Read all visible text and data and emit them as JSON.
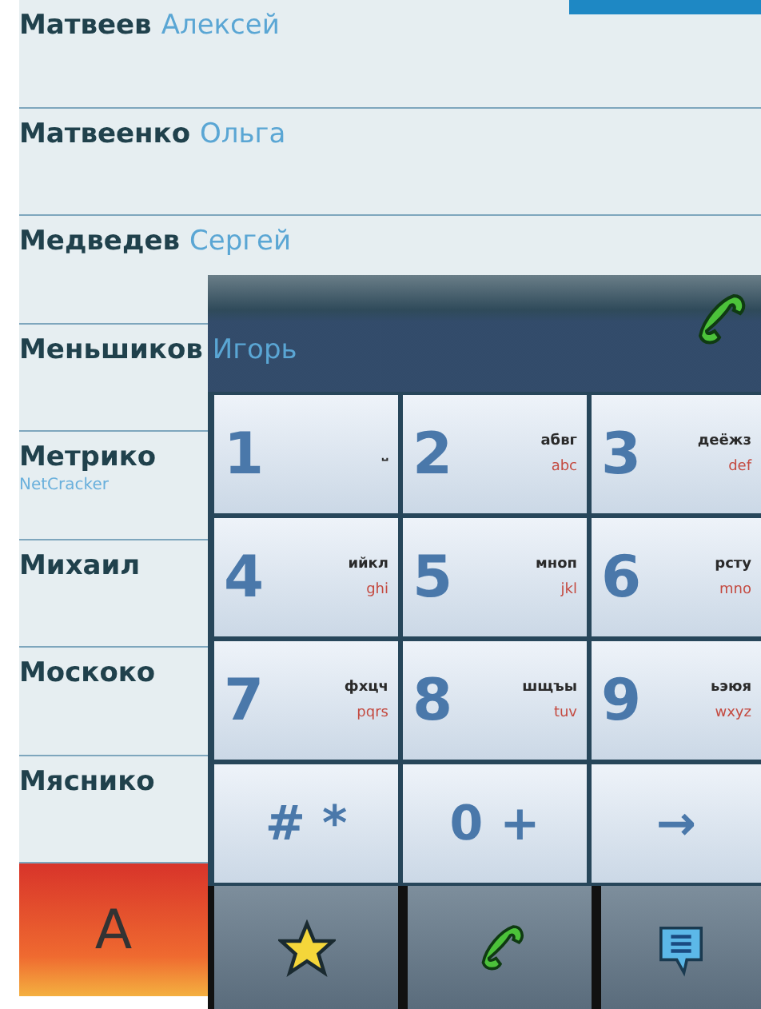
{
  "contacts": [
    {
      "surname": "Матвеев",
      "first_name": "Алексей"
    },
    {
      "surname": "Матвеенко",
      "first_name": "Ольга"
    },
    {
      "surname": "Медведев",
      "first_name": "Сергей"
    },
    {
      "surname": "Меньшиков",
      "first_name": "Игорь"
    },
    {
      "surname": "Метрико",
      "company": "NetCracker"
    },
    {
      "surname": "Михаил"
    },
    {
      "surname": "Москоко"
    },
    {
      "surname": "Мяснико"
    }
  ],
  "alphabet_button": {
    "label": "A",
    "selected": true
  },
  "dialpad": {
    "keys": [
      {
        "digit": "1",
        "letters_ru": "⎵"
      },
      {
        "digit": "2",
        "letters_ru": "абвг",
        "letters_en": "abc"
      },
      {
        "digit": "3",
        "letters_ru": "деёжз",
        "letters_en": "def"
      },
      {
        "digit": "4",
        "letters_ru": "ийкл",
        "letters_en": "ghi"
      },
      {
        "digit": "5",
        "letters_ru": "мноп",
        "letters_en": "jkl"
      },
      {
        "digit": "6",
        "letters_ru": "рсту",
        "letters_en": "mno"
      },
      {
        "digit": "7",
        "letters_ru": "фхцч",
        "letters_en": "pqrs"
      },
      {
        "digit": "8",
        "letters_ru": "шщъы",
        "letters_en": "tuv"
      },
      {
        "digit": "9",
        "letters_ru": "ьэюя",
        "letters_en": "wxyz"
      },
      {
        "digit": "# *"
      },
      {
        "digit": "0 +"
      },
      {
        "digit": "→"
      }
    ],
    "toolbar": [
      {
        "kind": "star",
        "selected": false
      },
      {
        "kind": "phone",
        "selected": false
      },
      {
        "kind": "message",
        "selected": false
      }
    ]
  }
}
